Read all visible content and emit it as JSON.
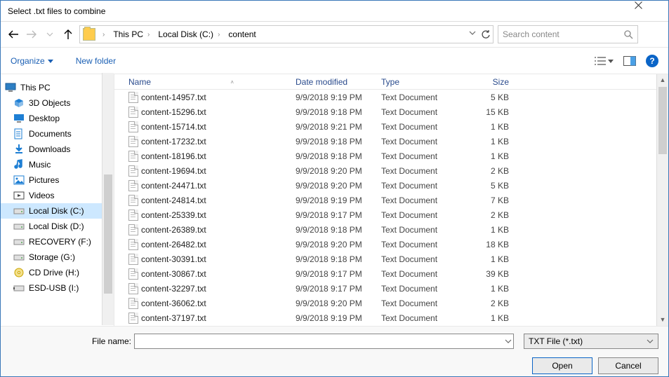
{
  "window": {
    "title": "Select .txt files to combine"
  },
  "breadcrumb": {
    "items": [
      "This PC",
      "Local Disk (C:)",
      "content"
    ]
  },
  "search": {
    "placeholder": "Search content"
  },
  "toolbar": {
    "organize": "Organize",
    "new_folder": "New folder"
  },
  "tree": {
    "root": "This PC",
    "items": [
      {
        "icon": "cube-icon",
        "color": "#1e7fd4",
        "label": "3D Objects"
      },
      {
        "icon": "desktop-icon",
        "color": "#1e7fd4",
        "label": "Desktop"
      },
      {
        "icon": "doc-icon",
        "color": "#1e7fd4",
        "label": "Documents"
      },
      {
        "icon": "download-icon",
        "color": "#1e7fd4",
        "label": "Downloads"
      },
      {
        "icon": "music-icon",
        "color": "#1e7fd4",
        "label": "Music"
      },
      {
        "icon": "picture-icon",
        "color": "#1e7fd4",
        "label": "Pictures"
      },
      {
        "icon": "video-icon",
        "color": "#444",
        "label": "Videos"
      },
      {
        "icon": "drive-icon",
        "color": "#888",
        "label": "Local Disk (C:)",
        "selected": true
      },
      {
        "icon": "drive-icon",
        "color": "#888",
        "label": "Local Disk (D:)"
      },
      {
        "icon": "drive-icon",
        "color": "#888",
        "label": "RECOVERY (F:)"
      },
      {
        "icon": "drive-icon",
        "color": "#888",
        "label": "Storage (G:)"
      },
      {
        "icon": "cd-icon",
        "color": "#c9a300",
        "label": "CD Drive (H:)"
      },
      {
        "icon": "usb-icon",
        "color": "#888",
        "label": "ESD-USB (I:)"
      }
    ]
  },
  "columns": {
    "name": "Name",
    "date": "Date modified",
    "type": "Type",
    "size": "Size"
  },
  "files": [
    {
      "name": "content-14957.txt",
      "date": "9/9/2018 9:19 PM",
      "type": "Text Document",
      "size": "5 KB"
    },
    {
      "name": "content-15296.txt",
      "date": "9/9/2018 9:18 PM",
      "type": "Text Document",
      "size": "15 KB"
    },
    {
      "name": "content-15714.txt",
      "date": "9/9/2018 9:21 PM",
      "type": "Text Document",
      "size": "1 KB"
    },
    {
      "name": "content-17232.txt",
      "date": "9/9/2018 9:18 PM",
      "type": "Text Document",
      "size": "1 KB"
    },
    {
      "name": "content-18196.txt",
      "date": "9/9/2018 9:18 PM",
      "type": "Text Document",
      "size": "1 KB"
    },
    {
      "name": "content-19694.txt",
      "date": "9/9/2018 9:20 PM",
      "type": "Text Document",
      "size": "2 KB"
    },
    {
      "name": "content-24471.txt",
      "date": "9/9/2018 9:20 PM",
      "type": "Text Document",
      "size": "5 KB"
    },
    {
      "name": "content-24814.txt",
      "date": "9/9/2018 9:19 PM",
      "type": "Text Document",
      "size": "7 KB"
    },
    {
      "name": "content-25339.txt",
      "date": "9/9/2018 9:17 PM",
      "type": "Text Document",
      "size": "2 KB"
    },
    {
      "name": "content-26389.txt",
      "date": "9/9/2018 9:18 PM",
      "type": "Text Document",
      "size": "1 KB"
    },
    {
      "name": "content-26482.txt",
      "date": "9/9/2018 9:20 PM",
      "type": "Text Document",
      "size": "18 KB"
    },
    {
      "name": "content-30391.txt",
      "date": "9/9/2018 9:18 PM",
      "type": "Text Document",
      "size": "1 KB"
    },
    {
      "name": "content-30867.txt",
      "date": "9/9/2018 9:17 PM",
      "type": "Text Document",
      "size": "39 KB"
    },
    {
      "name": "content-32297.txt",
      "date": "9/9/2018 9:17 PM",
      "type": "Text Document",
      "size": "1 KB"
    },
    {
      "name": "content-36062.txt",
      "date": "9/9/2018 9:20 PM",
      "type": "Text Document",
      "size": "2 KB"
    },
    {
      "name": "content-37197.txt",
      "date": "9/9/2018 9:19 PM",
      "type": "Text Document",
      "size": "1 KB"
    }
  ],
  "footer": {
    "filename_label": "File name:",
    "filename_value": "",
    "filetype_selected": "TXT File (*.txt)",
    "open": "Open",
    "cancel": "Cancel"
  }
}
